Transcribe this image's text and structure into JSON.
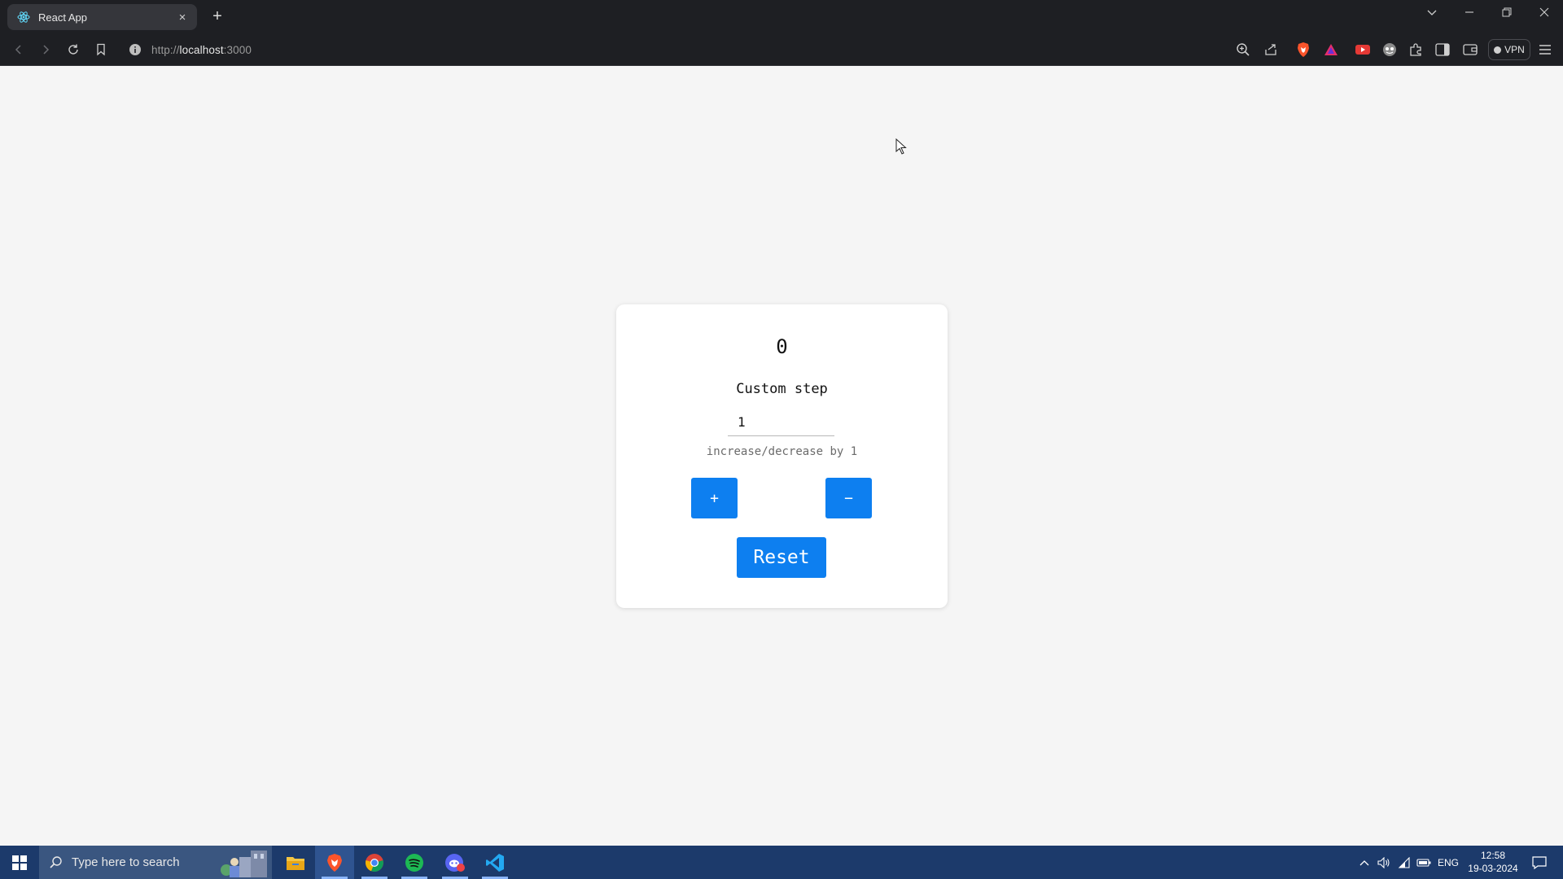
{
  "browser": {
    "tab_title": "React App",
    "tab_close": "×",
    "new_tab": "+",
    "url_scheme": "http://",
    "url_host": "localhost",
    "url_port": ":3000",
    "vpn_label": "VPN"
  },
  "app": {
    "counter_value": "0",
    "step_label": "Custom step",
    "step_value": "1",
    "helper_text": "increase/decrease by 1",
    "plus_label": "+",
    "minus_label": "−",
    "reset_label": "Reset",
    "button_color": "#0d7ff0"
  },
  "taskbar": {
    "search_placeholder": "Type here to search",
    "language": "ENG",
    "time": "12:58",
    "date": "19-03-2024"
  }
}
